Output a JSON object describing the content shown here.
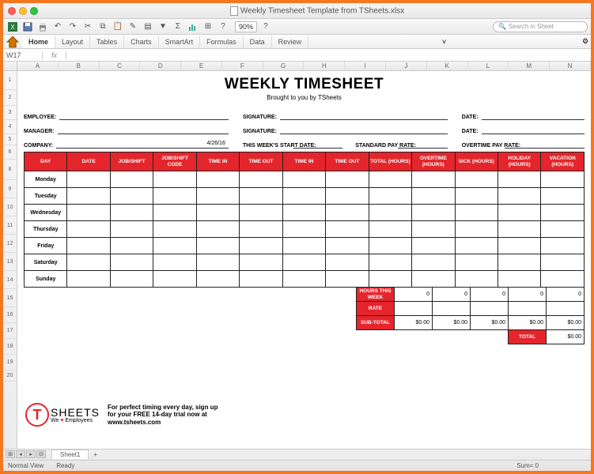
{
  "window": {
    "filename": "Weekly Timesheet Template from TSheets.xlsx",
    "zoom": "90%",
    "search_placeholder": "Search in Sheet"
  },
  "ribbon": {
    "tabs": [
      "Home",
      "Layout",
      "Tables",
      "Charts",
      "SmartArt",
      "Formulas",
      "Data",
      "Review"
    ],
    "cellref": "W17",
    "fx": "fx"
  },
  "columns": [
    "A",
    "B",
    "C",
    "D",
    "E",
    "F",
    "G",
    "H",
    "I",
    "J",
    "K",
    "L",
    "M",
    "N"
  ],
  "rows_labels": [
    "1",
    "",
    "2",
    "3",
    "4",
    "5",
    "6",
    "",
    "8",
    "9",
    "10",
    "11",
    "12",
    "13",
    "14",
    "15",
    "16",
    "17",
    "18",
    "19",
    "20"
  ],
  "doc": {
    "title": "WEEKLY TIMESHEET",
    "subtitle": "Brought to you by TSheets",
    "labels": {
      "employee": "EMPLOYEE:",
      "manager": "MANAGER:",
      "company": "COMPANY:",
      "signature": "SIGNATURE:",
      "date": "DATE:",
      "week_start": "THIS WEEK'S START DATE:",
      "std_rate": "STANDARD PAY RATE:",
      "ot_rate": "OVERTIME PAY RATE:"
    },
    "company_date": "4/26/16"
  },
  "headers": [
    "DAY",
    "DATE",
    "JOB/SHIFT",
    "JOB/SHIFT CODE",
    "TIME IN",
    "TIME OUT",
    "TIME IN",
    "TIME OUT",
    "TOTAL (HOURS)",
    "OVERTIME (HOURS)",
    "SICK (HOURS)",
    "HOLIDAY (HOURS)",
    "VACATION (HOURS)"
  ],
  "days": [
    "Monday",
    "Tuesday",
    "Wednesday",
    "Thursday",
    "Friday",
    "Saturday",
    "Sunday"
  ],
  "summary": {
    "hours_label": "HOURS THIS WEEK",
    "rate_label": "RATE",
    "subtotal_label": "SUB-TOTAL",
    "total_label": "TOTAL",
    "hours": [
      "0",
      "0",
      "0",
      "0",
      "0"
    ],
    "subtotals": [
      "$0.00",
      "$0.00",
      "$0.00",
      "$0.00",
      "$0.00"
    ],
    "total": "$0.00"
  },
  "logo": {
    "brand": "SHEETS",
    "tag_pre": "We ",
    "tag_post": " Employees",
    "promo1": "For perfect timing every day, sign up",
    "promo2": "for your FREE 14-day trial now at",
    "promo3": "www.tsheets.com"
  },
  "status": {
    "sheet": "Sheet1",
    "view": "Normal View",
    "ready": "Ready",
    "sum": "Sum= 0"
  }
}
